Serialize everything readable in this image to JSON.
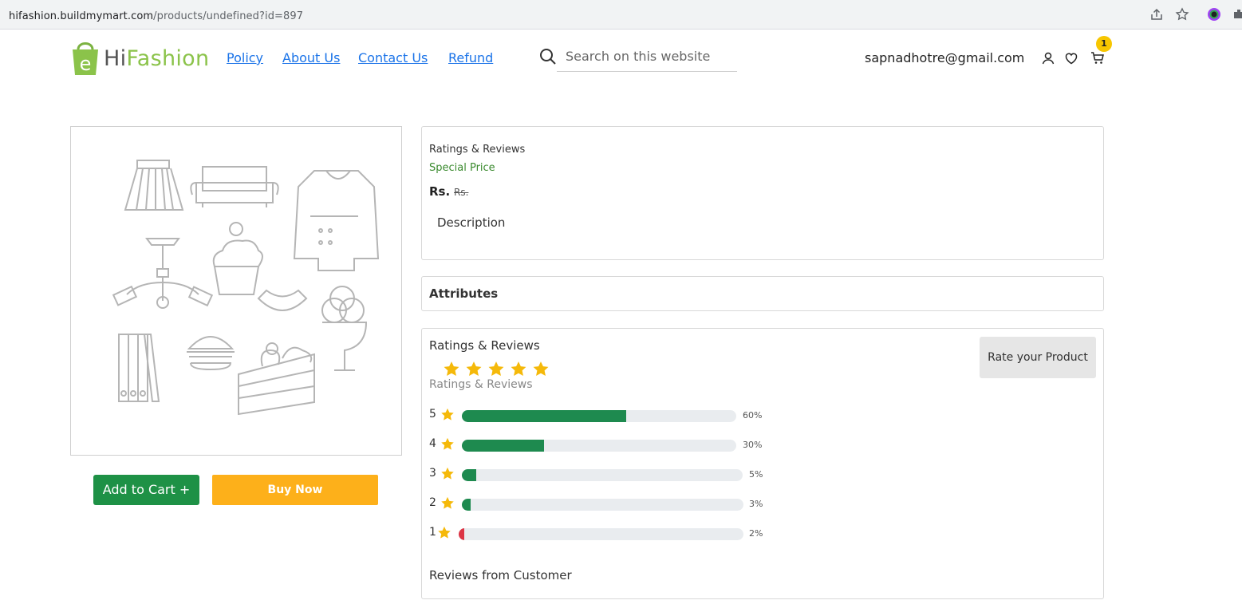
{
  "browser": {
    "url_domain": "hifashion.buildmymart.com",
    "url_path": "/products/undefined?id=897"
  },
  "header": {
    "brand_hi": "Hi",
    "brand_fashion": "Fashion",
    "nav": [
      "Policy",
      "About Us",
      "Contact Us",
      "Refund"
    ],
    "search_placeholder": "Search on this website",
    "user_email": "sapnadhotre@gmail.com",
    "cart_count": "1",
    "accent_color": "#8bc34a"
  },
  "actions": {
    "add_to_cart": "Add to Cart +",
    "buy_now": "Buy Now"
  },
  "product": {
    "ratings_title": "Ratings & Reviews",
    "special_price": "Special Price",
    "price_label": "Rs.",
    "old_price_label": "Rs.",
    "description_label": "Description"
  },
  "attributes": {
    "title": "Attributes"
  },
  "reviews": {
    "title": "Ratings & Reviews",
    "subtitle": "Ratings & Reviews",
    "rate_button": "Rate your Product",
    "star_count": 5,
    "bars": [
      {
        "stars": "5",
        "percent": 60,
        "label": "60%",
        "color": "#1e8a4f"
      },
      {
        "stars": "4",
        "percent": 30,
        "label": "30%",
        "color": "#1e8a4f"
      },
      {
        "stars": "3",
        "percent": 5,
        "label": "5%",
        "color": "#1e8a4f"
      },
      {
        "stars": "2",
        "percent": 3,
        "label": "3%",
        "color": "#1e8a4f"
      },
      {
        "stars": "1",
        "percent": 2,
        "label": "2%",
        "color": "#dc3545"
      }
    ],
    "customer_reviews_title": "Reviews from Customer"
  }
}
